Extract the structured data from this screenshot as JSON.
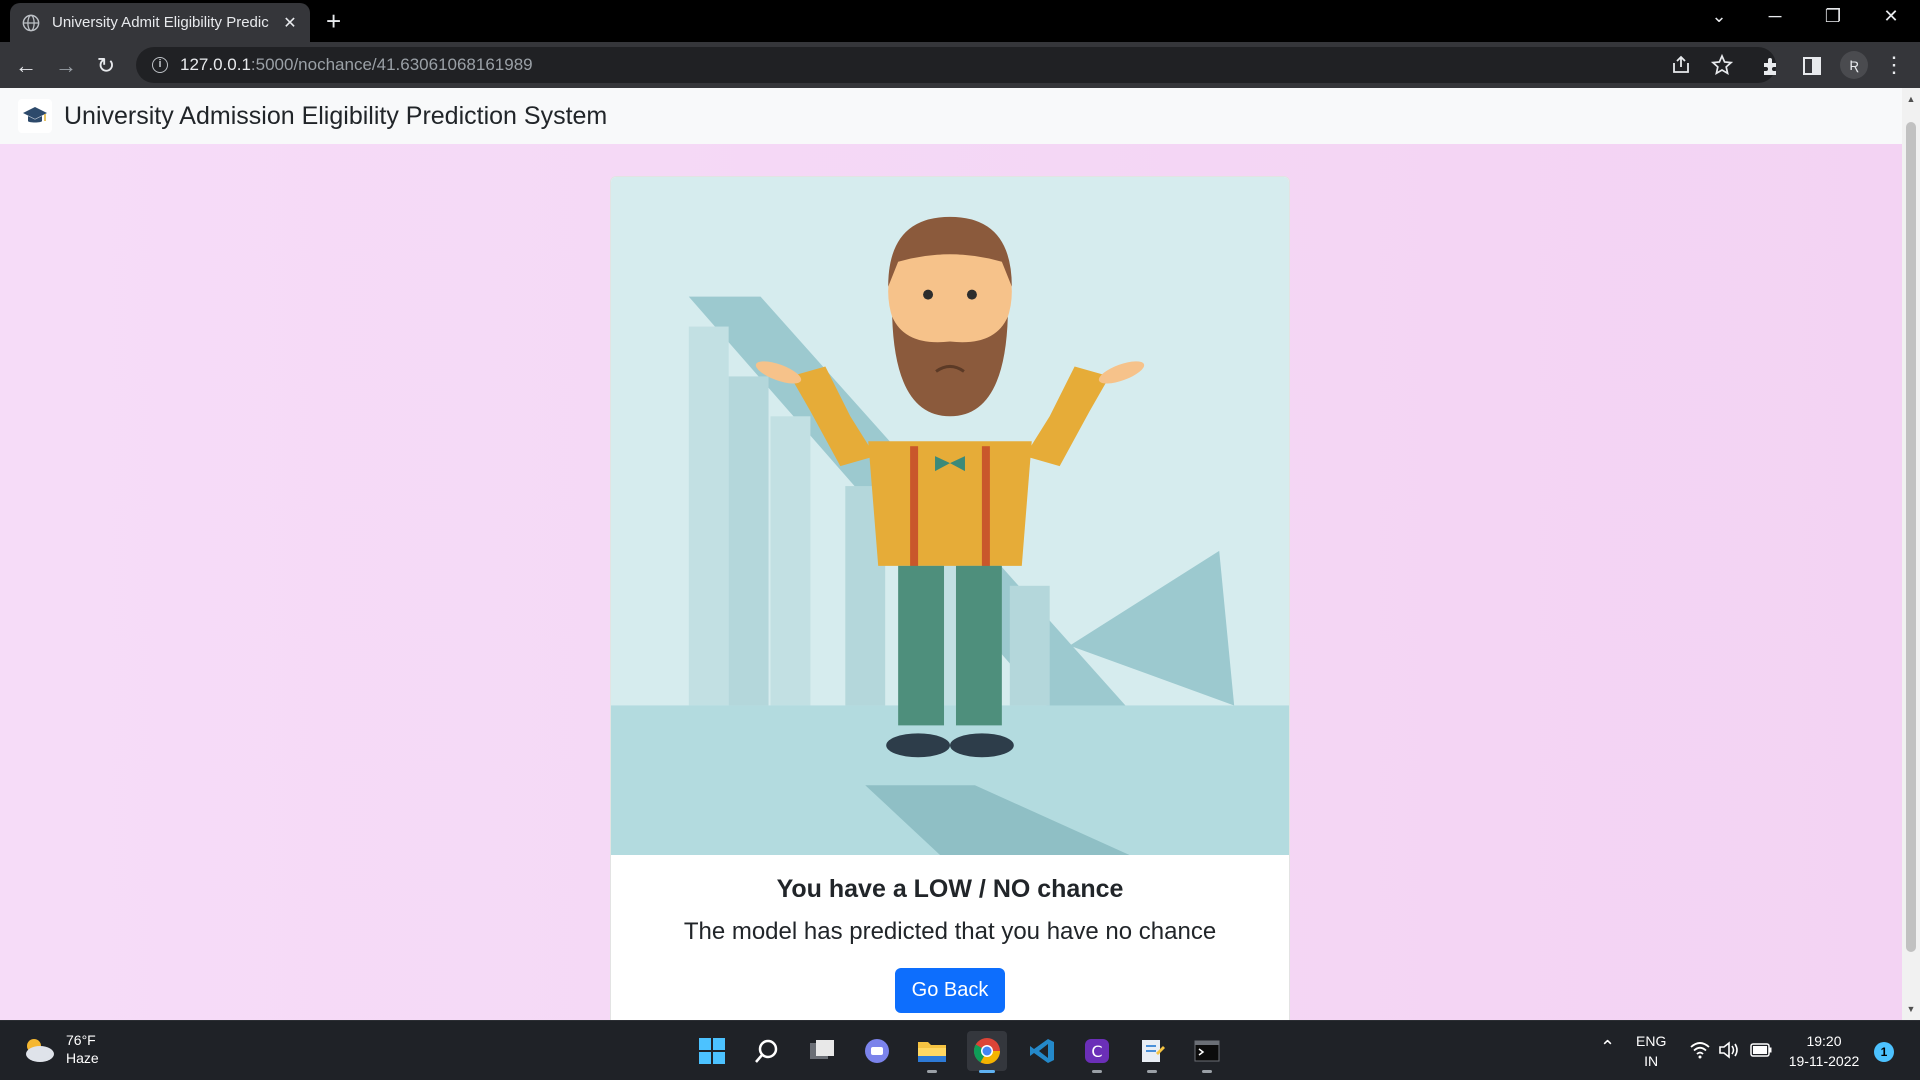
{
  "browser": {
    "tab_title": "University Admit Eligibility Predic",
    "tab_close": "✕",
    "new_tab": "+",
    "url_host": "127.0.0.1",
    "url_path": ":5000/nochance/41.63061068161989",
    "window_controls": {
      "minimize": "─",
      "restore": "❐",
      "close": "✕",
      "tab_search": "⌄"
    },
    "nav": {
      "back": "←",
      "forward": "→",
      "reload": "↻"
    },
    "profile_initial": "Ʀ"
  },
  "site": {
    "brand": "University Admission Eligibility Prediction System"
  },
  "card": {
    "title": "You have a LOW / NO chance",
    "text": "The model has predicted that you have no chance",
    "button": "Go Back"
  },
  "taskbar": {
    "weather_temp": "76°F",
    "weather_desc": "Haze",
    "lang_top": "ENG",
    "lang_bottom": "IN",
    "time": "19:20",
    "date": "19-11-2022",
    "notifications": "1"
  },
  "colors": {
    "page_bg": "#f4d6f5",
    "primary": "#0d6efd",
    "navbar": "#f8f9fa"
  }
}
